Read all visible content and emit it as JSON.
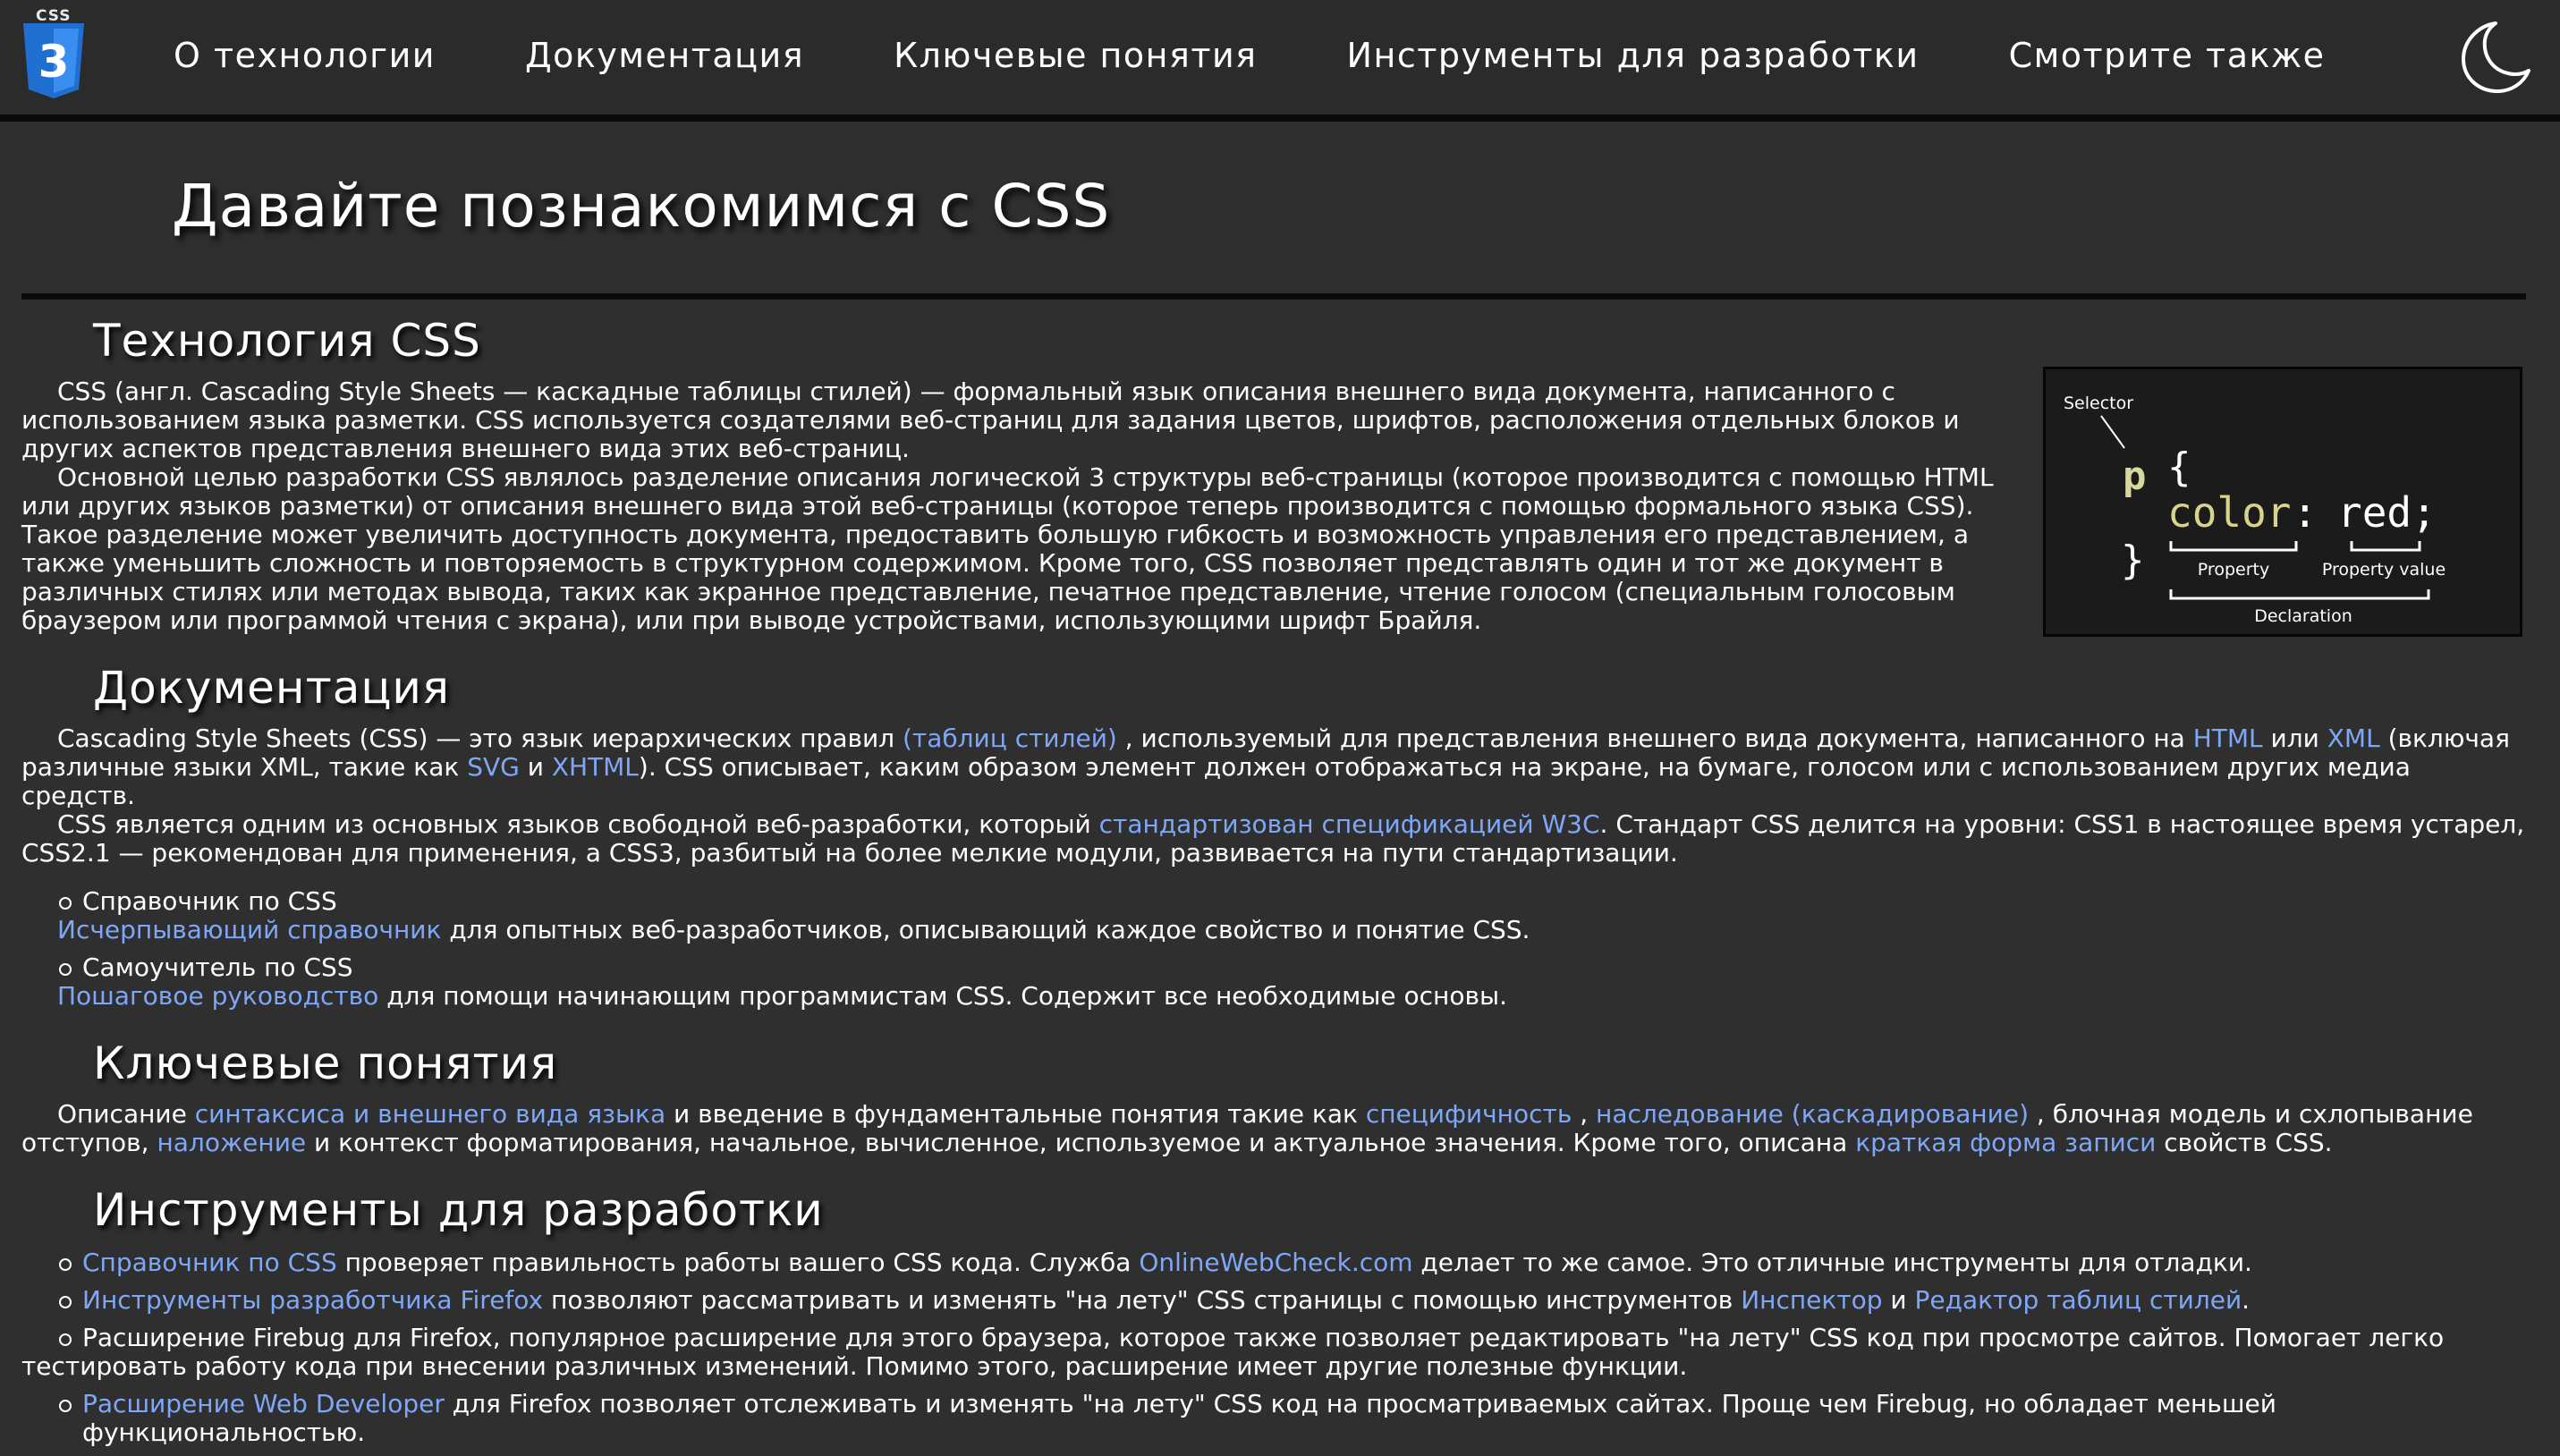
{
  "logo": {
    "word": "CSS",
    "digit": "3"
  },
  "nav": [
    {
      "label": "О технологии"
    },
    {
      "label": "Документация"
    },
    {
      "label": "Ключевые понятия"
    },
    {
      "label": "Инструменты для разработки"
    },
    {
      "label": "Смотрите также"
    }
  ],
  "theme_toggle": {
    "icon": "moon-icon"
  },
  "hero": {
    "title": "Давайте познакомимся с CSS"
  },
  "tech": {
    "heading": "Технология CSS",
    "p1": "CSS (англ. Cascading Style Sheets — каскадные таблицы стилей) — формальный язык описания внешнего вида документа, написанного с использованием языка разметки. CSS используется создателями веб-страниц для задания цветов, шрифтов, расположения отдельных блоков и других аспектов представления внешнего вида этих веб-страниц.",
    "p2": "Основной целью разработки CSS являлось разделение описания логической 3 структуры веб-страницы (которое производится с помощью HTML или других языков разметки) от описания внешнего вида этой веб-страницы (которое теперь производится с помощью формального языка CSS). Такое разделение может увеличить доступность документа, предоставить большую гибкость и возможность управления его представлением, а также уменьшить сложность и повторяемость в структурном содержимом. Кроме того, CSS позволяет представлять один и тот же документ в различных стилях или методах вывода, таких как экранное представление, печатное представление, чтение голосом (специальным голосовым браузером или программой чтения с экрана), или при выводе устройствами, использующими шрифт Брайля.",
    "diagram": {
      "selector_label": "Selector",
      "selector": "p",
      "open_brace": "{",
      "property": "color",
      "colon": ":",
      "value": "red;",
      "close_brace": "}",
      "property_label": "Property",
      "value_label": "Property value",
      "declaration_label": "Declaration"
    }
  },
  "docs": {
    "heading": "Документация",
    "p1": {
      "t1": "Cascading Style Sheets (CSS) — это язык иерархических правил ",
      "l1": "(таблиц стилей)",
      "t2": " , используемый для представления внешнего вида документа, написанного на ",
      "l2": "HTML",
      "t3": " или ",
      "l3": "XML",
      "t4": " (включая различные языки XML, такие как ",
      "l4": "SVG",
      "t5": " и ",
      "l5": "XHTML",
      "t6": "). CSS описывает, каким образом элемент должен отображаться на экране, на бумаге, голосом или с использованием других медиа средств."
    },
    "p2": {
      "t1": "CSS является одним из основных языков свободной веб-разработки, который ",
      "l1": "стандартизован спецификацией W3C",
      "t2": ". Стандарт CSS делится на уровни: CSS1 в настоящее время устарел, CSS2.1 — рекомендован для применения, а CSS3, разбитый на более мелкие модули, развивается на пути стандартизации."
    },
    "items": [
      {
        "title": "Справочник по CSS",
        "link": "Исчерпывающий справочник",
        "text": " для опытных веб-разработчиков, описывающий каждое свойство и понятие CSS."
      },
      {
        "title": "Самоучитель по CSS",
        "link": "Пошаговое руководство",
        "text": " для помощи начинающим программистам CSS. Содержит все необходимые основы."
      }
    ]
  },
  "key": {
    "heading": "Ключевые понятия",
    "t1": "Описание ",
    "l1": "синтаксиса и внешнего вида языка",
    "t2": " и введение в фундаментальные понятия такие как ",
    "l2": "специфичность",
    "t3": " , ",
    "l3": "наследование (каскадирование)",
    "t4": " , блочная модель и схлопывание отступов, ",
    "l4": "наложение",
    "t5": " и контекст форматирования, начальное, вычисленное, используемое и актуальное значения. Кроме того, описана ",
    "l5": "краткая форма записи",
    "t6": " свойств CSS."
  },
  "tools": {
    "heading": "Инструменты для разработки",
    "i1": {
      "l1": "Справочник по CSS",
      "t1": " проверяет правильность работы вашего CSS кода. Служба ",
      "l2": "OnlineWebCheck.com",
      "t2": " делает то же самое. Это отличные инструменты для отладки."
    },
    "i2": {
      "l1": "Инструменты разработчика Firefox",
      "t1": " позволяют рассматривать и изменять \"на лету\" CSS страницы с помощью инструментов ",
      "l2": "Инспектор",
      "t2": " и ",
      "l3": "Редактор таблиц стилей",
      "t3": "."
    },
    "i3": {
      "t1": "Расширение Firebug для Firefox, популярное расширение для этого браузера, которое также позволяет редактировать \"на лету\" CSS код при просмотре сайтов. Помогает легко тестировать работу кода при внесении различных изменений. Помимо этого, расширение имеет другие полезные функции."
    },
    "i4": {
      "l1": "Расширение Web Developer",
      "t1": " для Firefox позволяет отслеживать и изменять \"на лету\" CSS код на просматриваемых сайтах. Проще чем Firebug, но обладает меньшей функциональностью."
    }
  },
  "colors": {
    "background": "#2f2f2f",
    "header": "#2b2b2b",
    "link": "#7fa7f7",
    "code_selector": "#d7d7a0",
    "code_property": "#d8d48e"
  }
}
